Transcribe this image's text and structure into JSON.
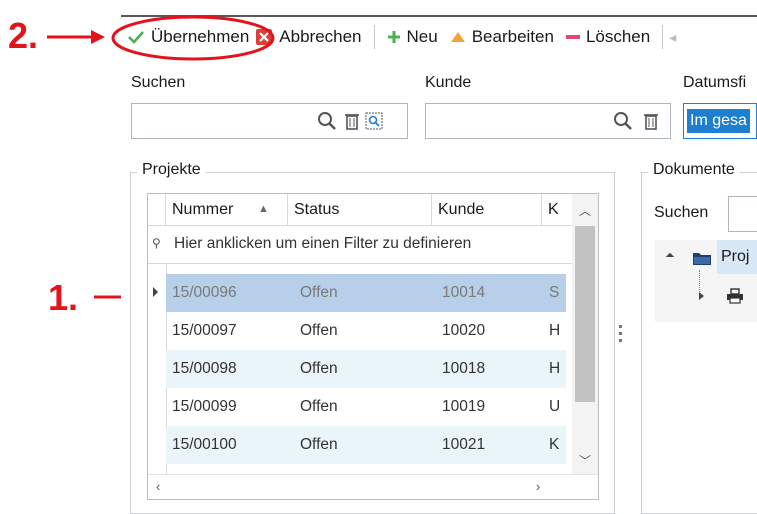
{
  "annotations": {
    "step1": "1.",
    "step2": "2."
  },
  "toolbar": {
    "uebernehmen": "Übernehmen",
    "abbrechen": "Abbrechen",
    "neu": "Neu",
    "bearbeiten": "Bearbeiten",
    "loeschen": "Löschen"
  },
  "filters": {
    "suchen_label": "Suchen",
    "suchen_value": "",
    "kunde_label": "Kunde",
    "kunde_value": "",
    "datum_label": "Datumsfi",
    "datum_value": "Im gesa"
  },
  "projekte": {
    "title": "Projekte",
    "columns": [
      "Nummer",
      "Status",
      "Kunde",
      "K"
    ],
    "filter_hint": "Hier anklicken um einen Filter zu definieren",
    "rows": [
      {
        "nummer": "15/00096",
        "status": "Offen",
        "kunde": "10014",
        "k": "S"
      },
      {
        "nummer": "15/00097",
        "status": "Offen",
        "kunde": "10020",
        "k": "H"
      },
      {
        "nummer": "15/00098",
        "status": "Offen",
        "kunde": "10018",
        "k": "H"
      },
      {
        "nummer": "15/00099",
        "status": "Offen",
        "kunde": "10019",
        "k": "U"
      },
      {
        "nummer": "15/00100",
        "status": "Offen",
        "kunde": "10021",
        "k": "K"
      }
    ]
  },
  "dokumente": {
    "title": "Dokumente",
    "suchen_label": "Suchen",
    "tree_root": "Proj"
  },
  "colors": {
    "accent": "#1e7fd0",
    "selection": "#b7cfe8",
    "annotation": "#e3131b"
  }
}
